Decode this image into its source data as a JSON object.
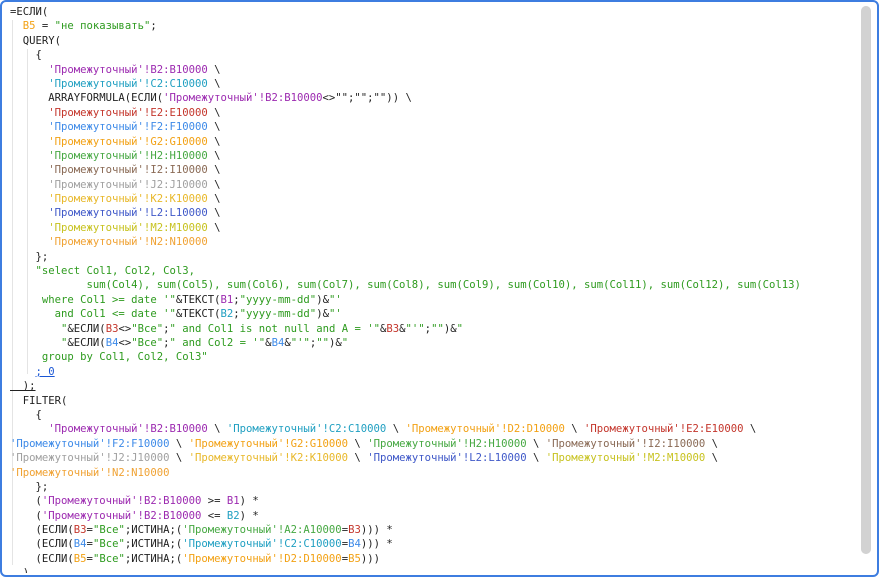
{
  "colors": {
    "default": "#222222",
    "string_green": "#2e9b1f",
    "range_purple": "#9c2ab0",
    "range_cyan": "#1f9fc1",
    "range_red": "#c4362c",
    "range_blue": "#3d8ae8",
    "range_orange": "#f2a114",
    "range_green": "#46a842",
    "range_brown": "#8a6a55",
    "range_gray": "#a0a0a0",
    "range_gold": "#e8b82a",
    "range_navy": "#3f58c8",
    "range_lime": "#c7c21f",
    "range_amber": "#f0a233",
    "link_blue": "#1a56d4"
  },
  "code_lines": [
    [
      {
        "t": "=ЕСЛИ(",
        "c": "default"
      }
    ],
    [
      {
        "t": "  B5",
        "c": "range_orange"
      },
      {
        "t": " = ",
        "c": "default"
      },
      {
        "t": "\"не показывать\"",
        "c": "string_green"
      },
      {
        "t": ";",
        "c": "default"
      }
    ],
    [
      {
        "t": "  QUERY(",
        "c": "default"
      }
    ],
    [
      {
        "t": "    {",
        "c": "default"
      }
    ],
    [
      {
        "t": "      'Промежуточный'!B2:B10000",
        "c": "range_purple"
      },
      {
        "t": " \\",
        "c": "default"
      }
    ],
    [
      {
        "t": "      'Промежуточный'!C2:C10000",
        "c": "range_cyan"
      },
      {
        "t": " \\",
        "c": "default"
      }
    ],
    [
      {
        "t": "      ARRAYFORMULA(ЕСЛИ(",
        "c": "default"
      },
      {
        "t": "'Промежуточный'!B2:B10000",
        "c": "range_purple"
      },
      {
        "t": "<>\"\";\"\";\"\")) \\",
        "c": "default"
      }
    ],
    [
      {
        "t": "      'Промежуточный'!E2:E10000",
        "c": "range_red"
      },
      {
        "t": " \\",
        "c": "default"
      }
    ],
    [
      {
        "t": "      'Промежуточный'!F2:F10000",
        "c": "range_blue"
      },
      {
        "t": " \\",
        "c": "default"
      }
    ],
    [
      {
        "t": "      'Промежуточный'!G2:G10000",
        "c": "range_orange"
      },
      {
        "t": " \\",
        "c": "default"
      }
    ],
    [
      {
        "t": "      'Промежуточный'!H2:H10000",
        "c": "range_green"
      },
      {
        "t": " \\",
        "c": "default"
      }
    ],
    [
      {
        "t": "      'Промежуточный'!I2:I10000",
        "c": "range_brown"
      },
      {
        "t": " \\",
        "c": "default"
      }
    ],
    [
      {
        "t": "      'Промежуточный'!J2:J10000",
        "c": "range_gray"
      },
      {
        "t": " \\",
        "c": "default"
      }
    ],
    [
      {
        "t": "      'Промежуточный'!K2:K10000",
        "c": "range_gold"
      },
      {
        "t": " \\",
        "c": "default"
      }
    ],
    [
      {
        "t": "      'Промежуточный'!L2:L10000",
        "c": "range_navy"
      },
      {
        "t": " \\",
        "c": "default"
      }
    ],
    [
      {
        "t": "      'Промежуточный'!M2:M10000",
        "c": "range_lime"
      },
      {
        "t": " \\",
        "c": "default"
      }
    ],
    [
      {
        "t": "      'Промежуточный'!N2:N10000",
        "c": "range_amber"
      }
    ],
    [
      {
        "t": "    };",
        "c": "default"
      }
    ],
    [
      {
        "t": "    \"select Col1, Col2, Col3,",
        "c": "string_green"
      }
    ],
    [
      {
        "t": "            sum(Col4), sum(Col5), sum(Col6), sum(Col7), sum(Col8), sum(Col9), sum(Col10), sum(Col11), sum(Col12), sum(Col13)",
        "c": "string_green"
      }
    ],
    [
      {
        "t": "     where Col1 >= date '\"",
        "c": "string_green"
      },
      {
        "t": "&ТЕКСТ(",
        "c": "default"
      },
      {
        "t": "B1",
        "c": "range_purple"
      },
      {
        "t": ";",
        "c": "default"
      },
      {
        "t": "\"yyyy-mm-dd\"",
        "c": "string_green"
      },
      {
        "t": ")&",
        "c": "default"
      },
      {
        "t": "\"'",
        "c": "string_green"
      }
    ],
    [
      {
        "t": "       and Col1 <= date '\"",
        "c": "string_green"
      },
      {
        "t": "&ТЕКСТ(",
        "c": "default"
      },
      {
        "t": "B2",
        "c": "range_cyan"
      },
      {
        "t": ";",
        "c": "default"
      },
      {
        "t": "\"yyyy-mm-dd\"",
        "c": "string_green"
      },
      {
        "t": ")&",
        "c": "default"
      },
      {
        "t": "\"'",
        "c": "string_green"
      }
    ],
    [
      {
        "t": "        \"",
        "c": "string_green"
      },
      {
        "t": "&ЕСЛИ(",
        "c": "default"
      },
      {
        "t": "B3",
        "c": "range_red"
      },
      {
        "t": "<>",
        "c": "default"
      },
      {
        "t": "\"Все\"",
        "c": "string_green"
      },
      {
        "t": ";",
        "c": "default"
      },
      {
        "t": "\" and Col1 is not null and A = '\"",
        "c": "string_green"
      },
      {
        "t": "&",
        "c": "default"
      },
      {
        "t": "B3",
        "c": "range_red"
      },
      {
        "t": "&",
        "c": "default"
      },
      {
        "t": "\"'\"",
        "c": "string_green"
      },
      {
        "t": ";",
        "c": "default"
      },
      {
        "t": "\"\"",
        "c": "string_green"
      },
      {
        "t": ")&",
        "c": "default"
      },
      {
        "t": "\"",
        "c": "string_green"
      }
    ],
    [
      {
        "t": "        \"",
        "c": "string_green"
      },
      {
        "t": "&ЕСЛИ(",
        "c": "default"
      },
      {
        "t": "B4",
        "c": "range_blue"
      },
      {
        "t": "<>",
        "c": "default"
      },
      {
        "t": "\"Все\"",
        "c": "string_green"
      },
      {
        "t": ";",
        "c": "default"
      },
      {
        "t": "\" and Col2 = '\"",
        "c": "string_green"
      },
      {
        "t": "&",
        "c": "default"
      },
      {
        "t": "B4",
        "c": "range_blue"
      },
      {
        "t": "&",
        "c": "default"
      },
      {
        "t": "\"'\"",
        "c": "string_green"
      },
      {
        "t": ";",
        "c": "default"
      },
      {
        "t": "\"\"",
        "c": "string_green"
      },
      {
        "t": ")&",
        "c": "default"
      },
      {
        "t": "\"",
        "c": "string_green"
      }
    ],
    [
      {
        "t": "     group by Col1, Col2, Col3\"",
        "c": "string_green"
      }
    ],
    [
      {
        "t": "    ",
        "c": "default"
      },
      {
        "t": "; 0",
        "c": "link_blue",
        "u": true
      }
    ],
    [
      {
        "t": "  );",
        "c": "default",
        "u": true
      }
    ],
    [
      {
        "t": "  FILTER(",
        "c": "default"
      }
    ],
    [
      {
        "t": "    {",
        "c": "default"
      }
    ],
    [
      {
        "t": "      'Промежуточный'!B2:B10000",
        "c": "range_purple"
      },
      {
        "t": " \\ ",
        "c": "default"
      },
      {
        "t": "'Промежуточный'!C2:C10000",
        "c": "range_cyan"
      },
      {
        "t": " \\ ",
        "c": "default"
      },
      {
        "t": "'Промежуточный'!D2:D10000",
        "c": "range_orange"
      },
      {
        "t": " \\ ",
        "c": "default"
      },
      {
        "t": "'Промежуточный'!E2:E10000",
        "c": "range_red"
      },
      {
        "t": " \\",
        "c": "default"
      }
    ],
    [
      {
        "t": "'Промежуточный'!F2:F10000",
        "c": "range_blue"
      },
      {
        "t": " \\ ",
        "c": "default"
      },
      {
        "t": "'Промежуточный'!G2:G10000",
        "c": "range_orange"
      },
      {
        "t": " \\ ",
        "c": "default"
      },
      {
        "t": "'Промежуточный'!H2:H10000",
        "c": "range_green"
      },
      {
        "t": " \\ ",
        "c": "default"
      },
      {
        "t": "'Промежуточный'!I2:I10000",
        "c": "range_brown"
      },
      {
        "t": " \\",
        "c": "default"
      }
    ],
    [
      {
        "t": "'Промежуточный'!J2:J10000",
        "c": "range_gray"
      },
      {
        "t": " \\ ",
        "c": "default"
      },
      {
        "t": "'Промежуточный'!K2:K10000",
        "c": "range_gold"
      },
      {
        "t": " \\ ",
        "c": "default"
      },
      {
        "t": "'Промежуточный'!L2:L10000",
        "c": "range_navy"
      },
      {
        "t": " \\ ",
        "c": "default"
      },
      {
        "t": "'Промежуточный'!M2:M10000",
        "c": "range_lime"
      },
      {
        "t": " \\",
        "c": "default"
      }
    ],
    [
      {
        "t": "'Промежуточный'!N2:N10000",
        "c": "range_amber"
      }
    ],
    [
      {
        "t": "    };",
        "c": "default"
      }
    ],
    [
      {
        "t": "    (",
        "c": "default"
      },
      {
        "t": "'Промежуточный'!B2:B10000",
        "c": "range_purple"
      },
      {
        "t": " >= ",
        "c": "default"
      },
      {
        "t": "B1",
        "c": "range_purple"
      },
      {
        "t": ") *",
        "c": "default"
      }
    ],
    [
      {
        "t": "    (",
        "c": "default"
      },
      {
        "t": "'Промежуточный'!B2:B10000",
        "c": "range_purple"
      },
      {
        "t": " <= ",
        "c": "default"
      },
      {
        "t": "B2",
        "c": "range_cyan"
      },
      {
        "t": ") *",
        "c": "default"
      }
    ],
    [
      {
        "t": "    (ЕСЛИ(",
        "c": "default"
      },
      {
        "t": "B3",
        "c": "range_red"
      },
      {
        "t": "=",
        "c": "default"
      },
      {
        "t": "\"Все\"",
        "c": "string_green"
      },
      {
        "t": ";ИСТИНА;(",
        "c": "default"
      },
      {
        "t": "'Промежуточный'!A2:A10000",
        "c": "range_green"
      },
      {
        "t": "=",
        "c": "default"
      },
      {
        "t": "B3",
        "c": "range_red"
      },
      {
        "t": "))) *",
        "c": "default"
      }
    ],
    [
      {
        "t": "    (ЕСЛИ(",
        "c": "default"
      },
      {
        "t": "B4",
        "c": "range_blue"
      },
      {
        "t": "=",
        "c": "default"
      },
      {
        "t": "\"Все\"",
        "c": "string_green"
      },
      {
        "t": ";ИСТИНА;(",
        "c": "default"
      },
      {
        "t": "'Промежуточный'!C2:C10000",
        "c": "range_cyan"
      },
      {
        "t": "=",
        "c": "default"
      },
      {
        "t": "B4",
        "c": "range_blue"
      },
      {
        "t": "))) *",
        "c": "default"
      }
    ],
    [
      {
        "t": "    (ЕСЛИ(",
        "c": "default"
      },
      {
        "t": "B5",
        "c": "range_orange"
      },
      {
        "t": "=",
        "c": "default"
      },
      {
        "t": "\"Все\"",
        "c": "string_green"
      },
      {
        "t": ";ИСТИНА;(",
        "c": "default"
      },
      {
        "t": "'Промежуточный'!D2:D10000",
        "c": "range_orange"
      },
      {
        "t": "=",
        "c": "default"
      },
      {
        "t": "B5",
        "c": "range_orange"
      },
      {
        "t": ")))",
        "c": "default"
      }
    ],
    [
      {
        "t": "  )",
        "c": "default"
      }
    ],
    [
      {
        "t": ")",
        "c": "default"
      }
    ]
  ]
}
